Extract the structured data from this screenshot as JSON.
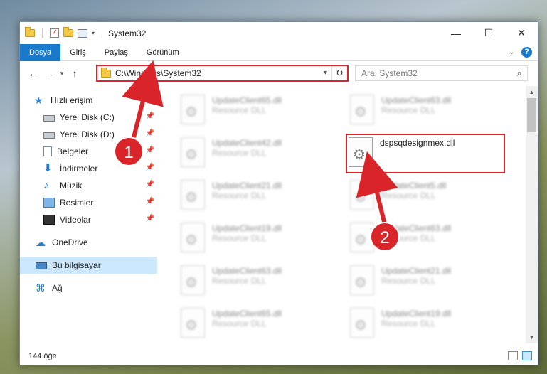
{
  "window": {
    "title": "System32"
  },
  "titlebar": {
    "controls": {
      "minimize": "—",
      "maximize": "☐",
      "close": "✕"
    }
  },
  "ribbon": {
    "tabs": [
      "Dosya",
      "Giriş",
      "Paylaş",
      "Görünüm"
    ],
    "active_tab": "Dosya",
    "help": "?"
  },
  "nav": {
    "back": "←",
    "forward": "→",
    "recent": "▾",
    "up": "↑",
    "address": "C:\\Windows\\System32",
    "address_dropdown": "▾",
    "refresh": "↻",
    "search_placeholder": "Ara: System32",
    "search_icon": "⌕"
  },
  "sidebar": {
    "items": [
      {
        "label": "Hızlı erişim",
        "icon": "star-icon",
        "pinned": false
      },
      {
        "label": "Yerel Disk (C:)",
        "icon": "drive-icon",
        "pinned": true
      },
      {
        "label": "Yerel Disk (D:)",
        "icon": "drive-icon",
        "pinned": true
      },
      {
        "label": "Belgeler",
        "icon": "documents-icon",
        "pinned": true
      },
      {
        "label": "İndirmeler",
        "icon": "downloads-icon",
        "pinned": true
      },
      {
        "label": "Müzik",
        "icon": "music-icon",
        "pinned": true
      },
      {
        "label": "Resimler",
        "icon": "pictures-icon",
        "pinned": true
      },
      {
        "label": "Videolar",
        "icon": "videos-icon",
        "pinned": true
      },
      {
        "label": "OneDrive",
        "icon": "onedrive-icon",
        "pinned": false
      },
      {
        "label": "Bu bilgisayar",
        "icon": "this-pc-icon",
        "pinned": false,
        "selected": true
      },
      {
        "label": "Ağ",
        "icon": "network-icon",
        "pinned": false
      }
    ],
    "pin_glyph": "📌"
  },
  "files": [
    {
      "name": "UpdateClient65.dll",
      "type": "Resource DLL",
      "blurred": true
    },
    {
      "name": "UpdateClient63.dll",
      "type": "Resource DLL",
      "blurred": true
    },
    {
      "name": "UpdateClient42.dll",
      "type": "Resource DLL",
      "blurred": true
    },
    {
      "name": "dspsqdesignmex.dll",
      "type": "",
      "blurred": false,
      "highlighted": true
    },
    {
      "name": "UpdateClient21.dll",
      "type": "Resource DLL",
      "blurred": true
    },
    {
      "name": "UpdateClient5.dll",
      "type": "Resource DLL",
      "blurred": true
    },
    {
      "name": "UpdateClient19.dll",
      "type": "Resource DLL",
      "blurred": true
    },
    {
      "name": "UpdateClient63.dll",
      "type": "Resource DLL",
      "blurred": true
    },
    {
      "name": "UpdateClient63.dll",
      "type": "Resource DLL",
      "blurred": true
    },
    {
      "name": "UpdateClient21.dll",
      "type": "Resource DLL",
      "blurred": true
    },
    {
      "name": "UpdateClient65.dll",
      "type": "Resource DLL",
      "blurred": true
    },
    {
      "name": "UpdateClient19.dll",
      "type": "Resource DLL",
      "blurred": true
    }
  ],
  "status": {
    "count": "144 öğe"
  },
  "annotations": {
    "step1": "1",
    "step2": "2",
    "color": "#d9252a"
  },
  "colors": {
    "accent": "#1979ca",
    "highlight": "#d9252a",
    "selected_bg": "#cce8ff"
  }
}
